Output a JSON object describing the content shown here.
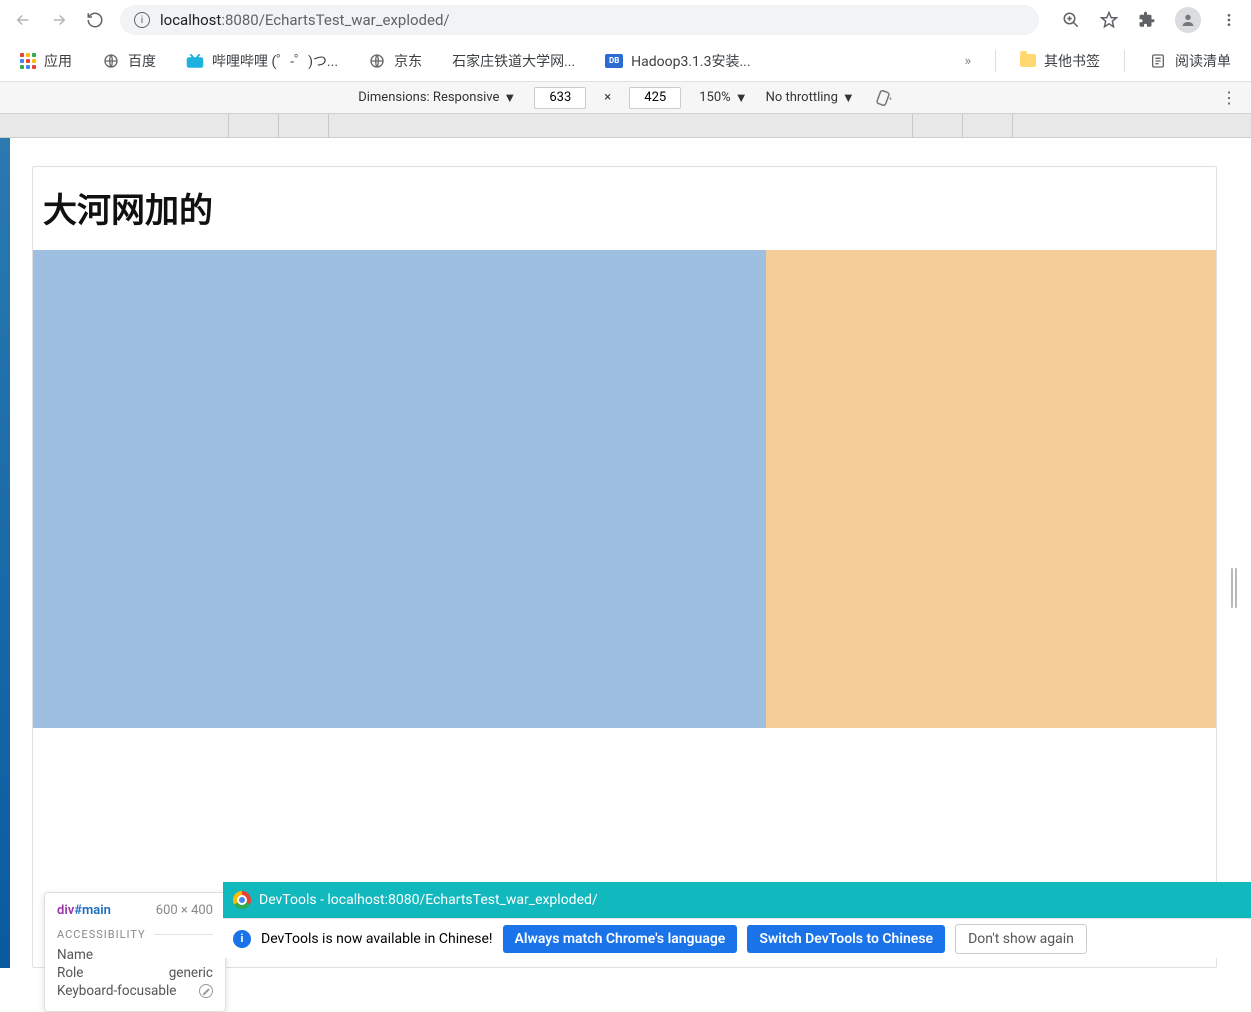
{
  "url": {
    "host": "localhost",
    "port": ":8080",
    "path": "/EchartsTest_war_exploded/"
  },
  "bookmarks": {
    "apps_label": "应用",
    "items": [
      "百度",
      "哔哩哔哩 (゜-゜)つ...",
      "京东",
      "石家庄铁道大学网...",
      "Hadoop3.1.3安装..."
    ],
    "overflow": "»",
    "other": "其他书签",
    "reading_list": "阅读清单"
  },
  "device_toolbar": {
    "dimensions_label": "Dimensions: Responsive",
    "width": "633",
    "sep": "×",
    "height": "425",
    "zoom": "150%",
    "throttling": "No throttling"
  },
  "page": {
    "title": "大河网加的"
  },
  "inspect": {
    "selector_tag": "div",
    "selector_id": "#main",
    "dims": "600 × 400",
    "section": "ACCESSIBILITY",
    "name_label": "Name",
    "role_label": "Role",
    "role_value": "generic",
    "kf_label": "Keyboard-focusable"
  },
  "footer": {
    "devtools_title": "DevTools - localhost:8080/EchartsTest_war_exploded/",
    "lang_msg": "DevTools is now available in Chinese!",
    "btn_always": "Always match Chrome's language",
    "btn_switch": "Switch DevTools to Chinese",
    "btn_dont": "Don't show again"
  }
}
